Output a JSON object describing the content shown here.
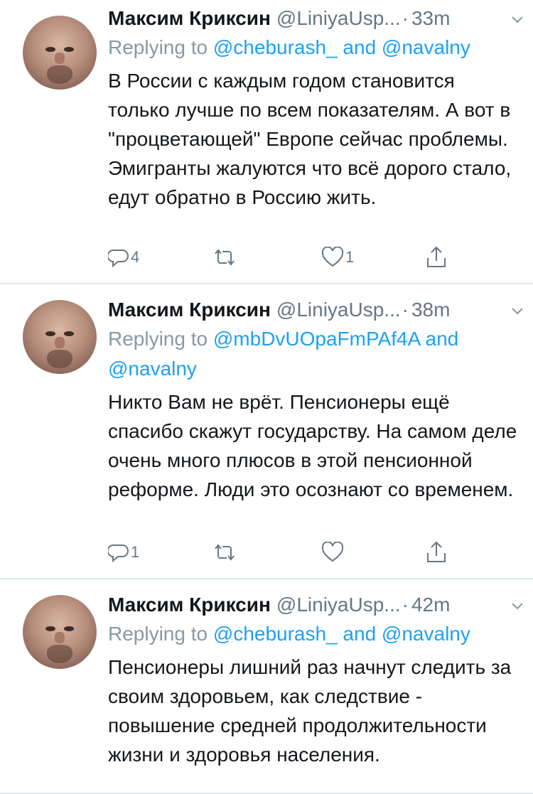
{
  "tweets": [
    {
      "name": "Максим Криксин",
      "handle": "@LiniyaUsp...",
      "dot": "·",
      "time": "33m",
      "replying_prefix": "Replying to",
      "mention_1": "@cheburash_",
      "and": "and",
      "mention_2": "@navalny",
      "text": "В России с каждым годом становится только лучше по всем показателям. А вот в \"процветающей\" Европе сейчас проблемы. Эмигранты жалуются что всё дорого стало, едут обратно в Россию жить.",
      "reply_count": "4",
      "retweet_count": "",
      "like_count": "1"
    },
    {
      "name": "Максим Криксин",
      "handle": "@LiniyaUsp...",
      "dot": "·",
      "time": "38m",
      "replying_prefix": "Replying to",
      "mention_1": "@mbDvUOpaFmPAf4A",
      "and": "and",
      "mention_2": "@navalny",
      "text": "Никто Вам не врёт. Пенсионеры ещё спасибо скажут государству. На самом деле очень много плюсов в этой пенсионной реформе. Люди это осознают со временем.",
      "reply_count": "1",
      "retweet_count": "",
      "like_count": ""
    },
    {
      "name": "Максим Криксин",
      "handle": "@LiniyaUsp...",
      "dot": "·",
      "time": "42m",
      "replying_prefix": "Replying to",
      "mention_1": "@cheburash_",
      "and": "and",
      "mention_2": "@navalny",
      "text": "Пенсионеры лишний раз начнут следить за своим здоровьем, как следствие - повышение средней продолжительности жизни и здоровья населения.",
      "reply_count": "",
      "retweet_count": "",
      "like_count": ""
    }
  ],
  "icons": {
    "reply": "reply-icon",
    "retweet": "retweet-icon",
    "like": "like-icon",
    "share": "share-icon",
    "more": "chevron-down-icon"
  },
  "colors": {
    "text": "#14171a",
    "secondary": "#657786",
    "mention": "#1da1f2",
    "divider": "#e1e8ed"
  }
}
